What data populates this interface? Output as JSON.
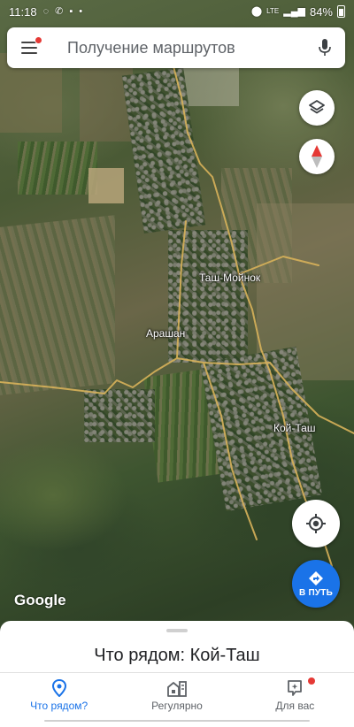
{
  "status_bar": {
    "time": "11:18",
    "signal_label": "LTE",
    "battery": "84%"
  },
  "search": {
    "placeholder": "Получение маршрутов"
  },
  "map": {
    "places": [
      {
        "name": "Таш-Мойнок"
      },
      {
        "name": "Арашан"
      },
      {
        "name": "Кой-Таш"
      }
    ],
    "attribution": "Google",
    "road_color": "#d8b25a"
  },
  "buttons": {
    "go_label": "В ПУТЬ"
  },
  "sheet": {
    "title": "Что рядом: Кой-Таш"
  },
  "bottom_nav": {
    "items": [
      {
        "label": "Что рядом?",
        "icon": "location-pin-icon",
        "active": true
      },
      {
        "label": "Регулярно",
        "icon": "commute-icon",
        "active": false
      },
      {
        "label": "Для вас",
        "icon": "for-you-icon",
        "active": false
      }
    ]
  },
  "colors": {
    "accent": "#1a73e8",
    "notification_dot": "#e53935"
  }
}
